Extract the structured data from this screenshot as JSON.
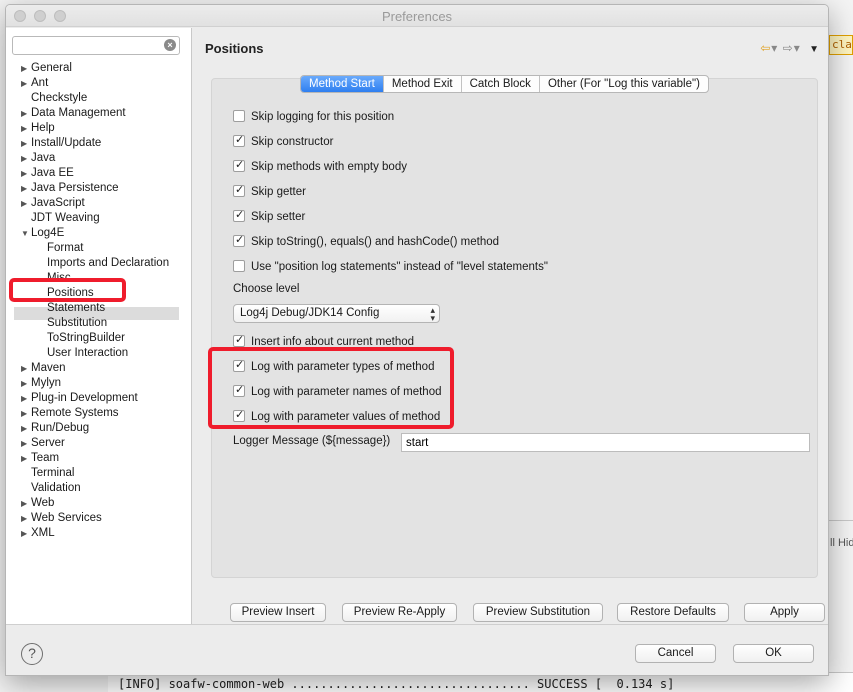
{
  "window": {
    "title": "Preferences"
  },
  "filter": {
    "placeholder": ""
  },
  "nav": {
    "items": [
      {
        "label": "General",
        "expandable": true,
        "depth": 0
      },
      {
        "label": "Ant",
        "expandable": true,
        "depth": 0
      },
      {
        "label": "Checkstyle",
        "expandable": false,
        "depth": 0
      },
      {
        "label": "Data Management",
        "expandable": true,
        "depth": 0
      },
      {
        "label": "Help",
        "expandable": true,
        "depth": 0
      },
      {
        "label": "Install/Update",
        "expandable": true,
        "depth": 0
      },
      {
        "label": "Java",
        "expandable": true,
        "depth": 0
      },
      {
        "label": "Java EE",
        "expandable": true,
        "depth": 0
      },
      {
        "label": "Java Persistence",
        "expandable": true,
        "depth": 0
      },
      {
        "label": "JavaScript",
        "expandable": true,
        "depth": 0
      },
      {
        "label": "JDT Weaving",
        "expandable": false,
        "depth": 0
      },
      {
        "label": "Log4E",
        "expandable": true,
        "expanded": true,
        "depth": 0
      },
      {
        "label": "Format",
        "expandable": false,
        "depth": 1
      },
      {
        "label": "Imports and Declaration",
        "expandable": false,
        "depth": 1
      },
      {
        "label": "Misc",
        "expandable": false,
        "depth": 1
      },
      {
        "label": "Positions",
        "expandable": false,
        "depth": 1,
        "selected": true
      },
      {
        "label": "Statements",
        "expandable": false,
        "depth": 1
      },
      {
        "label": "Substitution",
        "expandable": false,
        "depth": 1
      },
      {
        "label": "ToStringBuilder",
        "expandable": false,
        "depth": 1
      },
      {
        "label": "User Interaction",
        "expandable": false,
        "depth": 1
      },
      {
        "label": "Maven",
        "expandable": true,
        "depth": 0
      },
      {
        "label": "Mylyn",
        "expandable": true,
        "depth": 0
      },
      {
        "label": "Plug-in Development",
        "expandable": true,
        "depth": 0
      },
      {
        "label": "Remote Systems",
        "expandable": true,
        "depth": 0
      },
      {
        "label": "Run/Debug",
        "expandable": true,
        "depth": 0
      },
      {
        "label": "Server",
        "expandable": true,
        "depth": 0
      },
      {
        "label": "Team",
        "expandable": true,
        "depth": 0
      },
      {
        "label": "Terminal",
        "expandable": false,
        "depth": 0
      },
      {
        "label": "Validation",
        "expandable": false,
        "depth": 0
      },
      {
        "label": "Web",
        "expandable": true,
        "depth": 0
      },
      {
        "label": "Web Services",
        "expandable": true,
        "depth": 0
      },
      {
        "label": "XML",
        "expandable": true,
        "depth": 0
      }
    ]
  },
  "page": {
    "title": "Positions",
    "tabs": [
      {
        "label": "Method Start",
        "active": true
      },
      {
        "label": "Method Exit",
        "active": false
      },
      {
        "label": "Catch Block",
        "active": false
      },
      {
        "label": "Other (For \"Log this variable\")",
        "active": false
      }
    ],
    "options": [
      {
        "label": "Skip logging for this position",
        "checked": false
      },
      {
        "label": "Skip constructor",
        "checked": true
      },
      {
        "label": "Skip methods with empty body",
        "checked": true
      },
      {
        "label": "Skip getter",
        "checked": true
      },
      {
        "label": "Skip setter",
        "checked": true
      },
      {
        "label": "Skip toString(), equals() and hashCode() method",
        "checked": true
      },
      {
        "label": "Use \"position log statements\" instead of \"level statements\"",
        "checked": false
      }
    ],
    "choose_level_label": "Choose level",
    "level_select_value": "Log4j Debug/JDK14 Config",
    "options2": [
      {
        "label": "Insert info about current method",
        "checked": true
      },
      {
        "label": "Log with parameter types of method",
        "checked": true
      },
      {
        "label": "Log with parameter names of method",
        "checked": true
      },
      {
        "label": "Log with parameter values of method",
        "checked": true
      }
    ],
    "logger_message_label": "Logger Message (${message})",
    "logger_message_value": "start",
    "buttons": {
      "preview_insert": "Preview Insert",
      "preview_reapply": "Preview Re-Apply",
      "preview_substitution": "Preview Substitution",
      "restore_defaults": "Restore Defaults",
      "apply": "Apply"
    }
  },
  "footer": {
    "help": "?",
    "cancel": "Cancel",
    "ok": "OK"
  },
  "background": {
    "console_line": "[INFO] soafw-common-web ................................. SUCCESS [  0.134 s]",
    "editor_class_fragment": "class",
    "hide_fragment": "ll Hid"
  },
  "colors": {
    "annotation": "#ef1c2c",
    "active_tab": "#2f7ff0"
  }
}
